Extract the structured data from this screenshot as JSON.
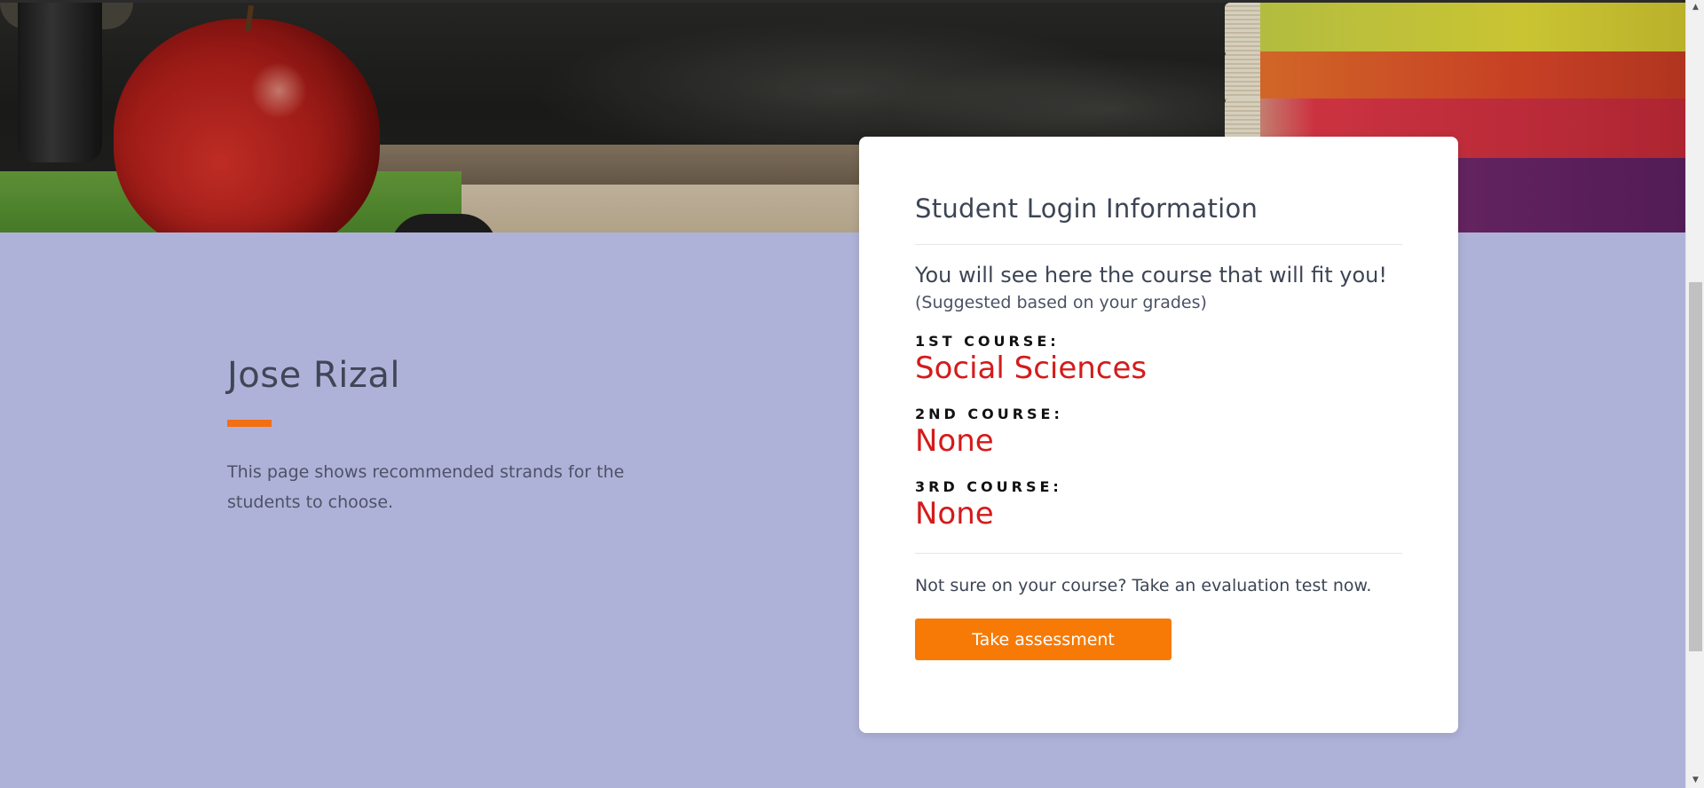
{
  "profile": {
    "name": "Jose Rizal",
    "description": "This page shows recommended strands for the students to choose."
  },
  "card": {
    "title": "Student Login Information",
    "lead": "You will see here the course that will fit you!",
    "sublead": "(Suggested based on your grades)",
    "courses": [
      {
        "label": "1ST COURSE:",
        "value": "Social Sciences"
      },
      {
        "label": "2ND COURSE:",
        "value": "None"
      },
      {
        "label": "3RD COURSE:",
        "value": "None"
      }
    ],
    "prompt": "Not sure on your course? Take an evaluation test now.",
    "button_label": "Take assessment"
  },
  "colors": {
    "page_background": "#afb2d8",
    "accent": "#f77a06",
    "course_value": "#d41b1b"
  },
  "scrollbar": {
    "up_icon": "▲",
    "down_icon": "▼"
  }
}
